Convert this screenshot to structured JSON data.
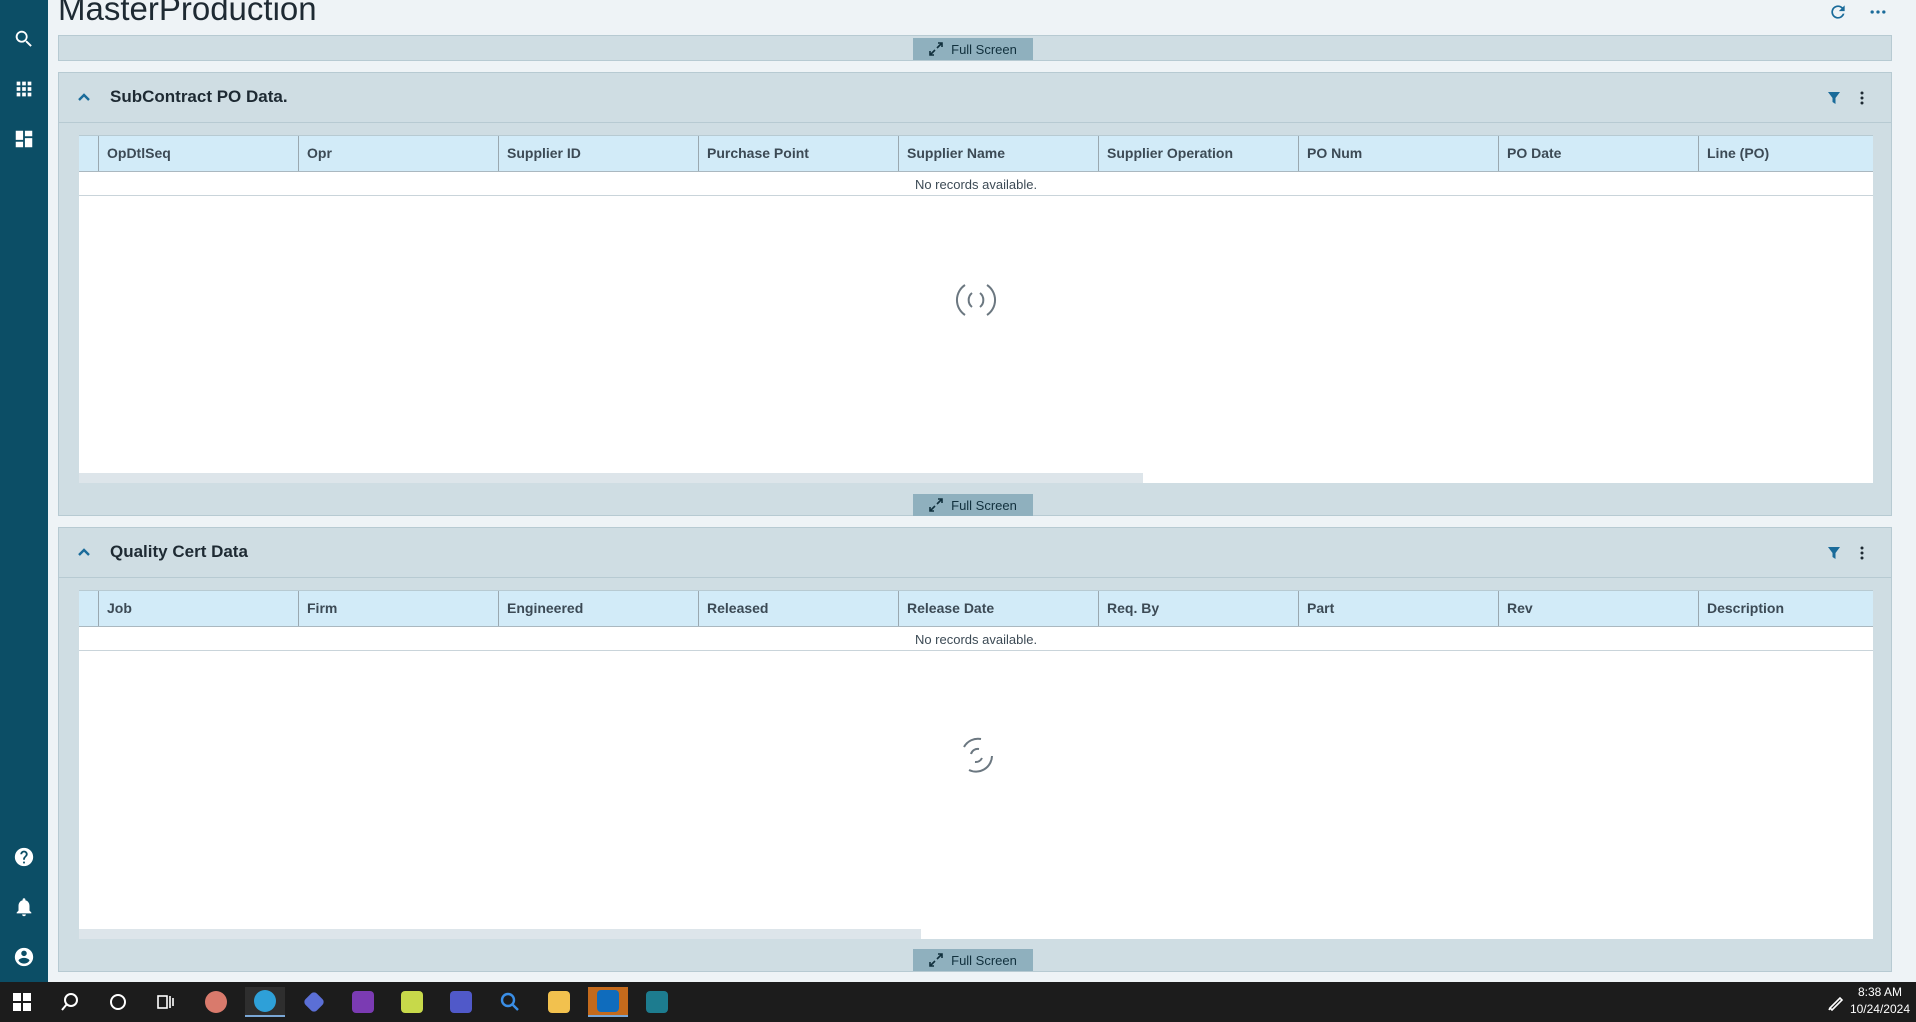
{
  "page": {
    "title": "MasterProduction"
  },
  "full_screen_label": "Full Screen",
  "panels": [
    {
      "title": "SubContract PO Data.",
      "columns": [
        "OpDtlSeq",
        "Opr",
        "Supplier ID",
        "Purchase Point",
        "Supplier Name",
        "Supplier Operation",
        "PO Num",
        "PO Date",
        "Line (PO)"
      ],
      "empty_text": "No records available."
    },
    {
      "title": "Quality Cert Data",
      "columns": [
        "Job",
        "Firm",
        "Engineered",
        "Released",
        "Release Date",
        "Req. By",
        "Part",
        "Rev",
        "Description"
      ],
      "empty_text": "No records available."
    }
  ],
  "sidebar": {
    "top": [
      "search-icon",
      "apps-grid-icon",
      "dashboard-icon"
    ],
    "bottom": [
      "help-icon",
      "notifications-bell-icon",
      "user-account-icon"
    ]
  },
  "taskbar": {
    "apps": [
      "windows-start-icon",
      "search-icon",
      "cortana-icon",
      "task-view-icon",
      "paint-icon",
      "edge-icon",
      "power-automate-icon",
      "onenote-icon",
      "sheet-app-icon",
      "teams-icon",
      "search-app-icon",
      "file-explorer-icon",
      "outlook-icon",
      "epicor-icon"
    ],
    "time": "8:38 AM",
    "date": "10/24/2024"
  },
  "colors": {
    "sidebar": "#0c4e66",
    "panel": "#cfdde3",
    "grid_header": "#d2ebf8",
    "accent": "#1a6b9a"
  }
}
